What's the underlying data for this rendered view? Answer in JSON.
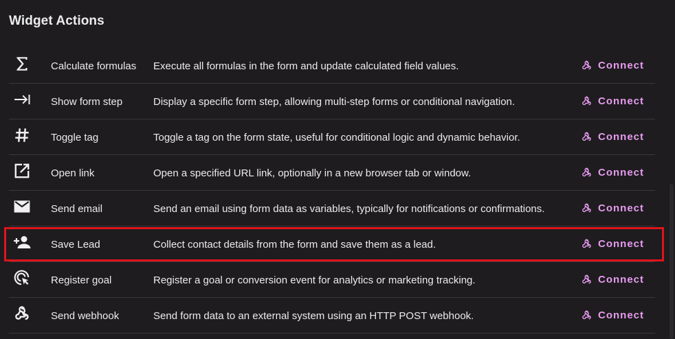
{
  "title": "Widget Actions",
  "colors": {
    "background": "#1e1c1f",
    "accent": "#e89cf0",
    "divider": "#3a383b",
    "highlight": "#e0141b"
  },
  "actions": [
    {
      "icon": "sigma-icon",
      "name": "Calculate formulas",
      "description": "Execute all formulas in the form and update calculated field values.",
      "connect_label": "Connect"
    },
    {
      "icon": "arrow-to-bar-icon",
      "name": "Show form step",
      "description": "Display a specific form step, allowing multi-step forms or conditional navigation.",
      "connect_label": "Connect"
    },
    {
      "icon": "hashtag-icon",
      "name": "Toggle tag",
      "description": "Toggle a tag on the form state, useful for conditional logic and dynamic behavior.",
      "connect_label": "Connect"
    },
    {
      "icon": "open-in-new-icon",
      "name": "Open link",
      "description": "Open a specified URL link, optionally in a new browser tab or window.",
      "connect_label": "Connect"
    },
    {
      "icon": "envelope-icon",
      "name": "Send email",
      "description": "Send an email using form data as variables, typically for notifications or confirmations.",
      "connect_label": "Connect"
    },
    {
      "icon": "person-add-icon",
      "name": "Save Lead",
      "description": "Collect contact details from the form and save them as a lead.",
      "connect_label": "Connect"
    },
    {
      "icon": "ads-click-icon",
      "name": "Register goal",
      "description": "Register a goal or conversion event for analytics or marketing tracking.",
      "connect_label": "Connect"
    },
    {
      "icon": "webhook-icon",
      "name": "Send webhook",
      "description": "Send form data to an external system using an HTTP POST webhook.",
      "connect_label": "Connect"
    }
  ]
}
